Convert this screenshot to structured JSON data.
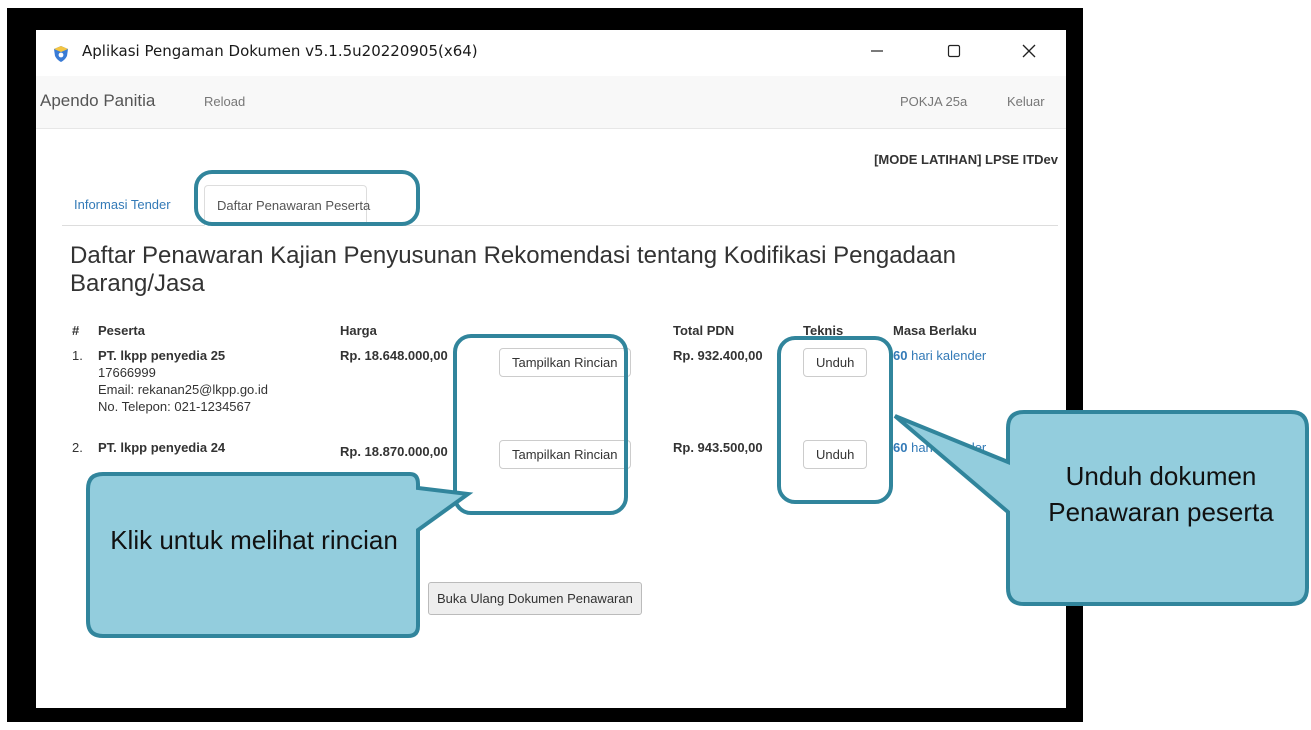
{
  "window": {
    "title": "Aplikasi Pengaman Dokumen v5.1.5u20220905(x64)",
    "minimize_icon": "minimize-icon",
    "maximize_icon": "maximize-icon",
    "close_icon": "close-icon"
  },
  "navbar": {
    "brand": "Apendo Panitia",
    "reload": "Reload",
    "user": "POKJA 25a",
    "logout": "Keluar"
  },
  "mode_label": "[MODE LATIHAN] LPSE ITDev",
  "tabs": [
    {
      "label": "Informasi Tender"
    },
    {
      "label": "Daftar Penawaran Peserta"
    }
  ],
  "page_title": "Daftar Penawaran Kajian Penyusunan Rekomendasi tentang Kodifikasi Pengadaan Barang/Jasa",
  "table": {
    "headers": [
      "#",
      "Peserta",
      "Harga",
      "",
      "Total PDN",
      "Teknis",
      "Masa Berlaku"
    ],
    "rows": [
      {
        "num": "1.",
        "name": "PT. lkpp penyedia 25",
        "npwp": "17666999",
        "email": "Email: rekanan25@lkpp.go.id",
        "phone": "No. Telepon: 021-1234567",
        "harga": "Rp. 18.648.000,00",
        "detail_button": "Tampilkan Rincian",
        "total_pdn": "Rp. 932.400,00",
        "teknis_button": "Unduh",
        "masa_value": "60",
        "masa_unit": "hari kalender"
      },
      {
        "num": "2.",
        "name": "PT. lkpp penyedia 24",
        "npwp": "",
        "email": "",
        "phone": "",
        "harga": "Rp. 18.870.000,00",
        "detail_button": "Tampilkan Rincian",
        "total_pdn": "Rp. 943.500,00",
        "teknis_button": "Unduh",
        "masa_value": "60",
        "masa_unit": "hari kalender"
      }
    ]
  },
  "reopen_button": "Buka Ulang Dokumen Penawaran",
  "annotations": {
    "left_callout": "Klik untuk melihat rincian",
    "right_callout": "Unduh dokumen Penawaran peserta",
    "color_fill": "#93cddd",
    "color_border": "#31859c"
  }
}
